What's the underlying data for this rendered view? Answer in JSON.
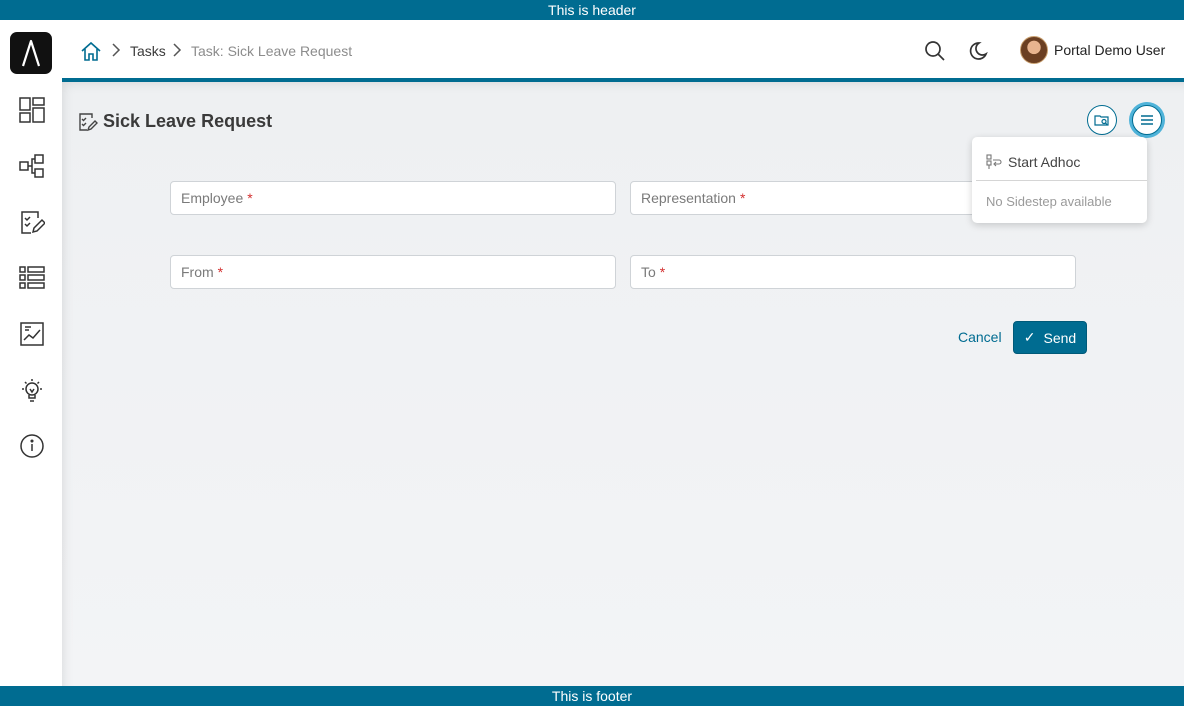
{
  "frame": {
    "header_text": "This is header",
    "footer_text": "This is footer"
  },
  "colors": {
    "accent": "#006c91",
    "required": "#d32f2f",
    "focus_ring": "#4fb3d9"
  },
  "sidebar": {
    "items": [
      {
        "icon": "dashboard-icon"
      },
      {
        "icon": "process-icon"
      },
      {
        "icon": "tasks-icon"
      },
      {
        "icon": "cases-icon"
      },
      {
        "icon": "statistics-icon"
      },
      {
        "icon": "lightbulb-icon"
      },
      {
        "icon": "info-icon"
      }
    ]
  },
  "header": {
    "breadcrumb": {
      "home_icon": "home-icon",
      "tasks": "Tasks",
      "current": "Task: Sick Leave Request"
    },
    "user_name": "Portal Demo User"
  },
  "page": {
    "title": "Sick Leave Request"
  },
  "form": {
    "fields": [
      {
        "label": "Employee",
        "required": "*"
      },
      {
        "label": "Representation",
        "required": "*"
      },
      {
        "label": "From",
        "required": "*"
      },
      {
        "label": "To",
        "required": "*"
      }
    ],
    "cancel_label": "Cancel",
    "send_label": "Send",
    "send_icon": "✓"
  },
  "task_menu": {
    "start_adhoc": "Start Adhoc",
    "no_sidestep": "No Sidestep available"
  }
}
